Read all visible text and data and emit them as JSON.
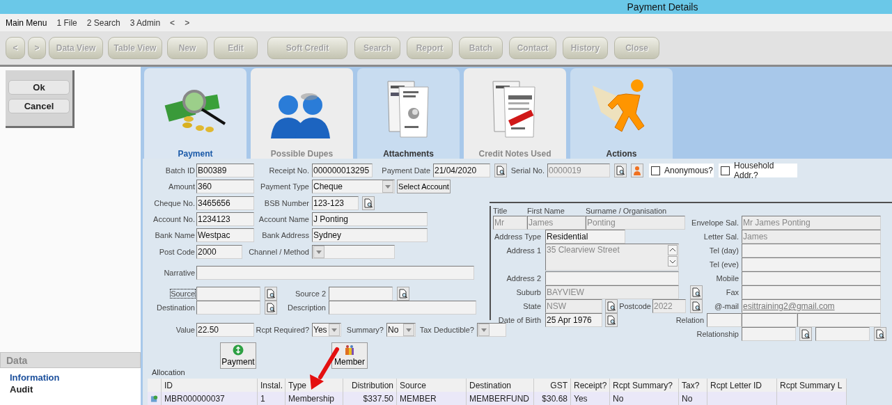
{
  "window": {
    "title": "Payment Details"
  },
  "menu_bar": [
    "Main Menu",
    "1 File",
    "2 Search",
    "3 Admin",
    "<",
    ">"
  ],
  "toolbar": [
    "<",
    ">",
    "Data View",
    "Table View",
    "New",
    "Edit",
    "Soft Credit",
    "Search",
    "Report",
    "Batch",
    "Contact",
    "History",
    "Close"
  ],
  "dialog_buttons": [
    "Ok",
    "Cancel"
  ],
  "sidebar": {
    "title": "Data",
    "items": [
      {
        "label": "Information",
        "selected": true
      },
      {
        "label": "Audit",
        "selected": false
      }
    ]
  },
  "tabs": [
    {
      "label": "Payment",
      "selected": true,
      "disabled": false
    },
    {
      "label": "Possible Dupes",
      "selected": false,
      "disabled": true
    },
    {
      "label": "Attachments",
      "selected": false,
      "disabled": false
    },
    {
      "label": "Credit Notes Used",
      "selected": false,
      "disabled": true
    },
    {
      "label": "Actions",
      "selected": false,
      "disabled": false
    }
  ],
  "payment_form": {
    "lines": [
      [
        {
          "kind": "label",
          "text": "Batch ID"
        },
        {
          "kind": "field",
          "value": "B00389",
          "disabled": false
        },
        {
          "kind": "label",
          "text": "Receipt No."
        },
        {
          "kind": "field",
          "value": "000000013295",
          "disabled": false
        },
        {
          "kind": "label",
          "text": "Payment Date"
        },
        {
          "kind": "field",
          "value": "21/04/2020",
          "disabled": false
        },
        {
          "kind": "lookup"
        },
        {
          "kind": "label",
          "text": "Serial No."
        },
        {
          "kind": "field",
          "value": "0000019",
          "disabled": true
        },
        {
          "kind": "lookup"
        },
        {
          "kind": "person_button"
        },
        {
          "kind": "checkbox",
          "label": "Anonymous?",
          "checked": false
        },
        {
          "kind": "checkbox",
          "label": "Household Addr.?",
          "checked": false
        }
      ],
      [
        {
          "kind": "label",
          "text": "Amount"
        },
        {
          "kind": "field",
          "value": "360",
          "disabled": false
        },
        {
          "kind": "label",
          "text": "Payment Type"
        },
        {
          "kind": "select",
          "value": "Cheque"
        },
        {
          "kind": "button",
          "label": "Select Account"
        }
      ],
      [
        {
          "kind": "label",
          "text": "Cheque No."
        },
        {
          "kind": "field",
          "value": "3465656",
          "disabled": false
        },
        {
          "kind": "label",
          "text": "BSB Number"
        },
        {
          "kind": "field",
          "value": "123-123",
          "disabled": false
        },
        {
          "kind": "lookup"
        }
      ],
      [
        {
          "kind": "label",
          "text": "Account No."
        },
        {
          "kind": "field",
          "value": "1234123",
          "disabled": false
        },
        {
          "kind": "label",
          "text": "Account Name"
        },
        {
          "kind": "field",
          "value": "J Ponting",
          "disabled": false
        }
      ],
      [
        {
          "kind": "label",
          "text": "Bank Name"
        },
        {
          "kind": "field",
          "value": "Westpac",
          "disabled": false
        },
        {
          "kind": "label",
          "text": "Bank Address"
        },
        {
          "kind": "field",
          "value": "Sydney",
          "disabled": false
        }
      ],
      [
        {
          "kind": "label",
          "text": "Post Code"
        },
        {
          "kind": "field",
          "value": "2000",
          "disabled": false
        },
        {
          "kind": "label",
          "text": "Channel / Method"
        },
        {
          "kind": "select"
        }
      ],
      [
        {
          "kind": "label",
          "text": "Narrative"
        },
        {
          "kind": "field"
        }
      ],
      [
        {
          "kind": "focused_label",
          "text": "Source"
        },
        {
          "kind": "field"
        },
        {
          "kind": "lookup"
        },
        {
          "kind": "label",
          "text": "Source 2"
        },
        {
          "kind": "field"
        },
        {
          "kind": "lookup"
        }
      ],
      [
        {
          "kind": "label",
          "text": "Destination"
        },
        {
          "kind": "field"
        },
        {
          "kind": "lookup"
        },
        {
          "kind": "label",
          "text": "Description"
        },
        {
          "kind": "field"
        }
      ],
      [
        {
          "kind": "label",
          "text": "Value"
        },
        {
          "kind": "field",
          "value": "22.50",
          "disabled": false
        },
        {
          "kind": "label",
          "text": "Rcpt Required?"
        },
        {
          "kind": "select",
          "value": "Yes"
        },
        {
          "kind": "label",
          "text": "Summary?"
        },
        {
          "kind": "select",
          "value": "No"
        },
        {
          "kind": "label",
          "text": "Tax Deductible?"
        },
        {
          "kind": "select"
        }
      ],
      [
        {
          "kind": "icon_button",
          "label": "Payment"
        },
        {
          "kind": "icon_button",
          "label": "Member"
        }
      ]
    ]
  },
  "contact_panel": {
    "items": [
      {
        "kind": "small_label",
        "text": "Title"
      },
      {
        "kind": "small_label",
        "text": "First Name"
      },
      {
        "kind": "small_label",
        "text": "Surname / Organisation"
      },
      {
        "kind": "field",
        "value": "Mr",
        "disabled": true
      },
      {
        "kind": "field",
        "value": "James",
        "disabled": true
      },
      {
        "kind": "field",
        "value": "Ponting",
        "disabled": true
      },
      {
        "kind": "label",
        "text": "Envelope Sal."
      },
      {
        "kind": "field",
        "value": "Mr James Ponting",
        "disabled": true
      },
      {
        "kind": "label",
        "text": "Address Type"
      },
      {
        "kind": "field",
        "value": "Residential",
        "disabled": false
      },
      {
        "kind": "label",
        "text": "Letter Sal."
      },
      {
        "kind": "field",
        "value": "James",
        "disabled": true
      },
      {
        "kind": "label",
        "text": "Address 1"
      },
      {
        "kind": "textarea",
        "value": "35 Clearview Street",
        "disabled": true
      },
      {
        "kind": "label",
        "text": "Tel (day)"
      },
      {
        "kind": "field"
      },
      {
        "kind": "label",
        "text": "Tel (eve)"
      },
      {
        "kind": "field"
      },
      {
        "kind": "label",
        "text": "Address 2"
      },
      {
        "kind": "field"
      },
      {
        "kind": "label",
        "text": "Mobile"
      },
      {
        "kind": "field"
      },
      {
        "kind": "label",
        "text": "Suburb"
      },
      {
        "kind": "field",
        "value": "BAYVIEW",
        "disabled": true
      },
      {
        "kind": "lookup"
      },
      {
        "kind": "label",
        "text": "Fax"
      },
      {
        "kind": "field"
      },
      {
        "kind": "label",
        "text": "State"
      },
      {
        "kind": "field",
        "value": "NSW",
        "disabled": true
      },
      {
        "kind": "lookup"
      },
      {
        "kind": "label",
        "text": "Postcode"
      },
      {
        "kind": "field",
        "value": "2022",
        "disabled": true
      },
      {
        "kind": "lookup"
      },
      {
        "kind": "label",
        "text": "@-mail"
      },
      {
        "kind": "email_field",
        "value": "esittraining2@gmail.com"
      },
      {
        "kind": "label",
        "text": "Date of Birth"
      },
      {
        "kind": "field",
        "value": "25 Apr 1976",
        "disabled": false
      },
      {
        "kind": "lookup"
      },
      {
        "kind": "label",
        "text": "Relation"
      },
      {
        "kind": "field"
      },
      {
        "kind": "field"
      },
      {
        "kind": "field"
      },
      {
        "kind": "label",
        "text": "Relationship"
      },
      {
        "kind": "field"
      },
      {
        "kind": "lookup"
      },
      {
        "kind": "field"
      },
      {
        "kind": "lookup"
      }
    ]
  },
  "allocation": {
    "title": "Allocation",
    "columns": [
      "ID",
      "Instal.",
      "Type",
      "Distribution",
      "Source",
      "Destination",
      "GST",
      "Receipt?",
      "Rcpt Summary?",
      "Tax?",
      "Rcpt Letter ID",
      "Rcpt Summary L"
    ],
    "rows": [
      {
        "selected": true,
        "cells": [
          "MBR000000037",
          "1",
          "Membership",
          "$337.50",
          "MEMBER",
          "MEMBERFUND",
          "$30.68",
          "Yes",
          "No",
          "No"
        ]
      }
    ]
  }
}
